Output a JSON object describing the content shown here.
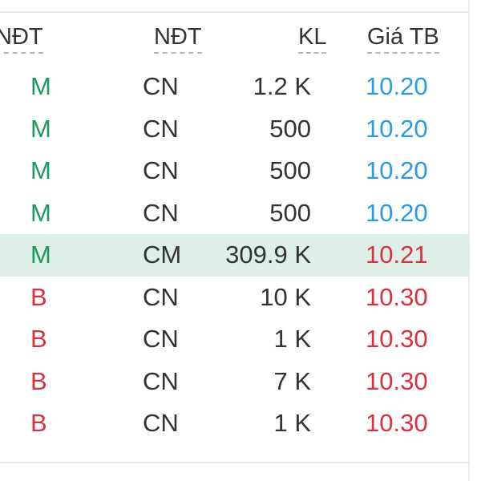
{
  "header": {
    "col_investor_left": "NĐT",
    "col_investor": "NĐT",
    "col_volume": "KL",
    "col_avg_price": "Giá TB"
  },
  "rows": [
    {
      "lead": "0",
      "side": "M",
      "side_type": "buy",
      "investor": "CN",
      "volume": "1.2 K",
      "price": "10.20",
      "price_color": "#2a9be0",
      "highlight": false
    },
    {
      "lead": "8",
      "side": "M",
      "side_type": "buy",
      "investor": "CN",
      "volume": "500",
      "price": "10.20",
      "price_color": "#2a9be0",
      "highlight": false
    },
    {
      "lead": "7",
      "side": "M",
      "side_type": "buy",
      "investor": "CN",
      "volume": "500",
      "price": "10.20",
      "price_color": "#2a9be0",
      "highlight": false
    },
    {
      "lead": "3",
      "side": "M",
      "side_type": "buy",
      "investor": "CN",
      "volume": "500",
      "price": "10.20",
      "price_color": "#2a9be0",
      "highlight": false
    },
    {
      "lead": "1",
      "side": "M",
      "side_type": "buy",
      "investor": "CM",
      "volume": "309.9 K",
      "price": "10.21",
      "price_color": "#d8303e",
      "highlight": true
    },
    {
      "lead": "3",
      "side": "B",
      "side_type": "sell",
      "investor": "CN",
      "volume": "10 K",
      "price": "10.30",
      "price_color": "#d8303e",
      "highlight": false
    },
    {
      "lead": "0",
      "side": "B",
      "side_type": "sell",
      "investor": "CN",
      "volume": "1 K",
      "price": "10.30",
      "price_color": "#d8303e",
      "highlight": false
    },
    {
      "lead": "8",
      "side": "B",
      "side_type": "sell",
      "investor": "CN",
      "volume": "7 K",
      "price": "10.30",
      "price_color": "#d8303e",
      "highlight": false
    },
    {
      "lead": "0",
      "side": "B",
      "side_type": "sell",
      "investor": "CN",
      "volume": "1 K",
      "price": "10.30",
      "price_color": "#d8303e",
      "highlight": false
    }
  ],
  "colors": {
    "buy": "#1a9a5c",
    "sell": "#d8303e",
    "price_blue": "#2a9be0",
    "highlight_bg": "#deefe8"
  }
}
